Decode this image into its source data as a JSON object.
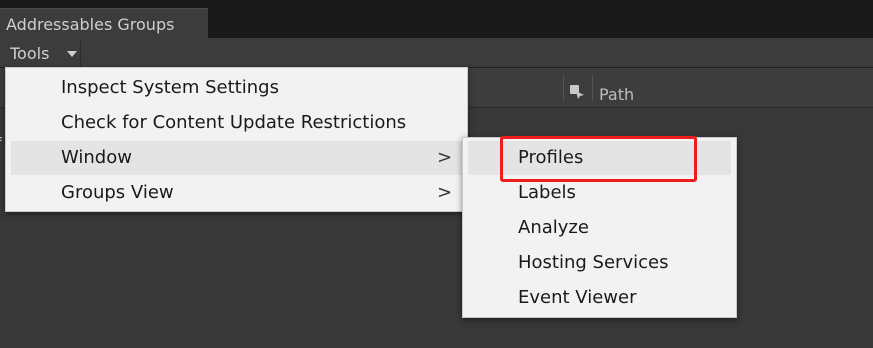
{
  "window": {
    "tab_title": "Addressables Groups"
  },
  "toolbar": {
    "tools_label": "Tools"
  },
  "table": {
    "columns": [
      {
        "icon": "addressable-icon",
        "label": ""
      },
      {
        "label": "Path"
      }
    ],
    "stray_text": "f"
  },
  "tools_menu": {
    "items": [
      {
        "label": "Inspect System Settings",
        "submenu": false
      },
      {
        "label": "Check for Content Update Restrictions",
        "submenu": false
      },
      {
        "label": "Window",
        "submenu": true,
        "arrow": ">"
      },
      {
        "label": "Groups View",
        "submenu": true,
        "arrow": ">"
      }
    ]
  },
  "window_submenu": {
    "items": [
      {
        "label": "Profiles"
      },
      {
        "label": "Labels"
      },
      {
        "label": "Analyze"
      },
      {
        "label": "Hosting Services"
      },
      {
        "label": "Event Viewer"
      }
    ]
  },
  "annotation": {
    "color": "#ee1c1c",
    "target": "Profiles"
  }
}
